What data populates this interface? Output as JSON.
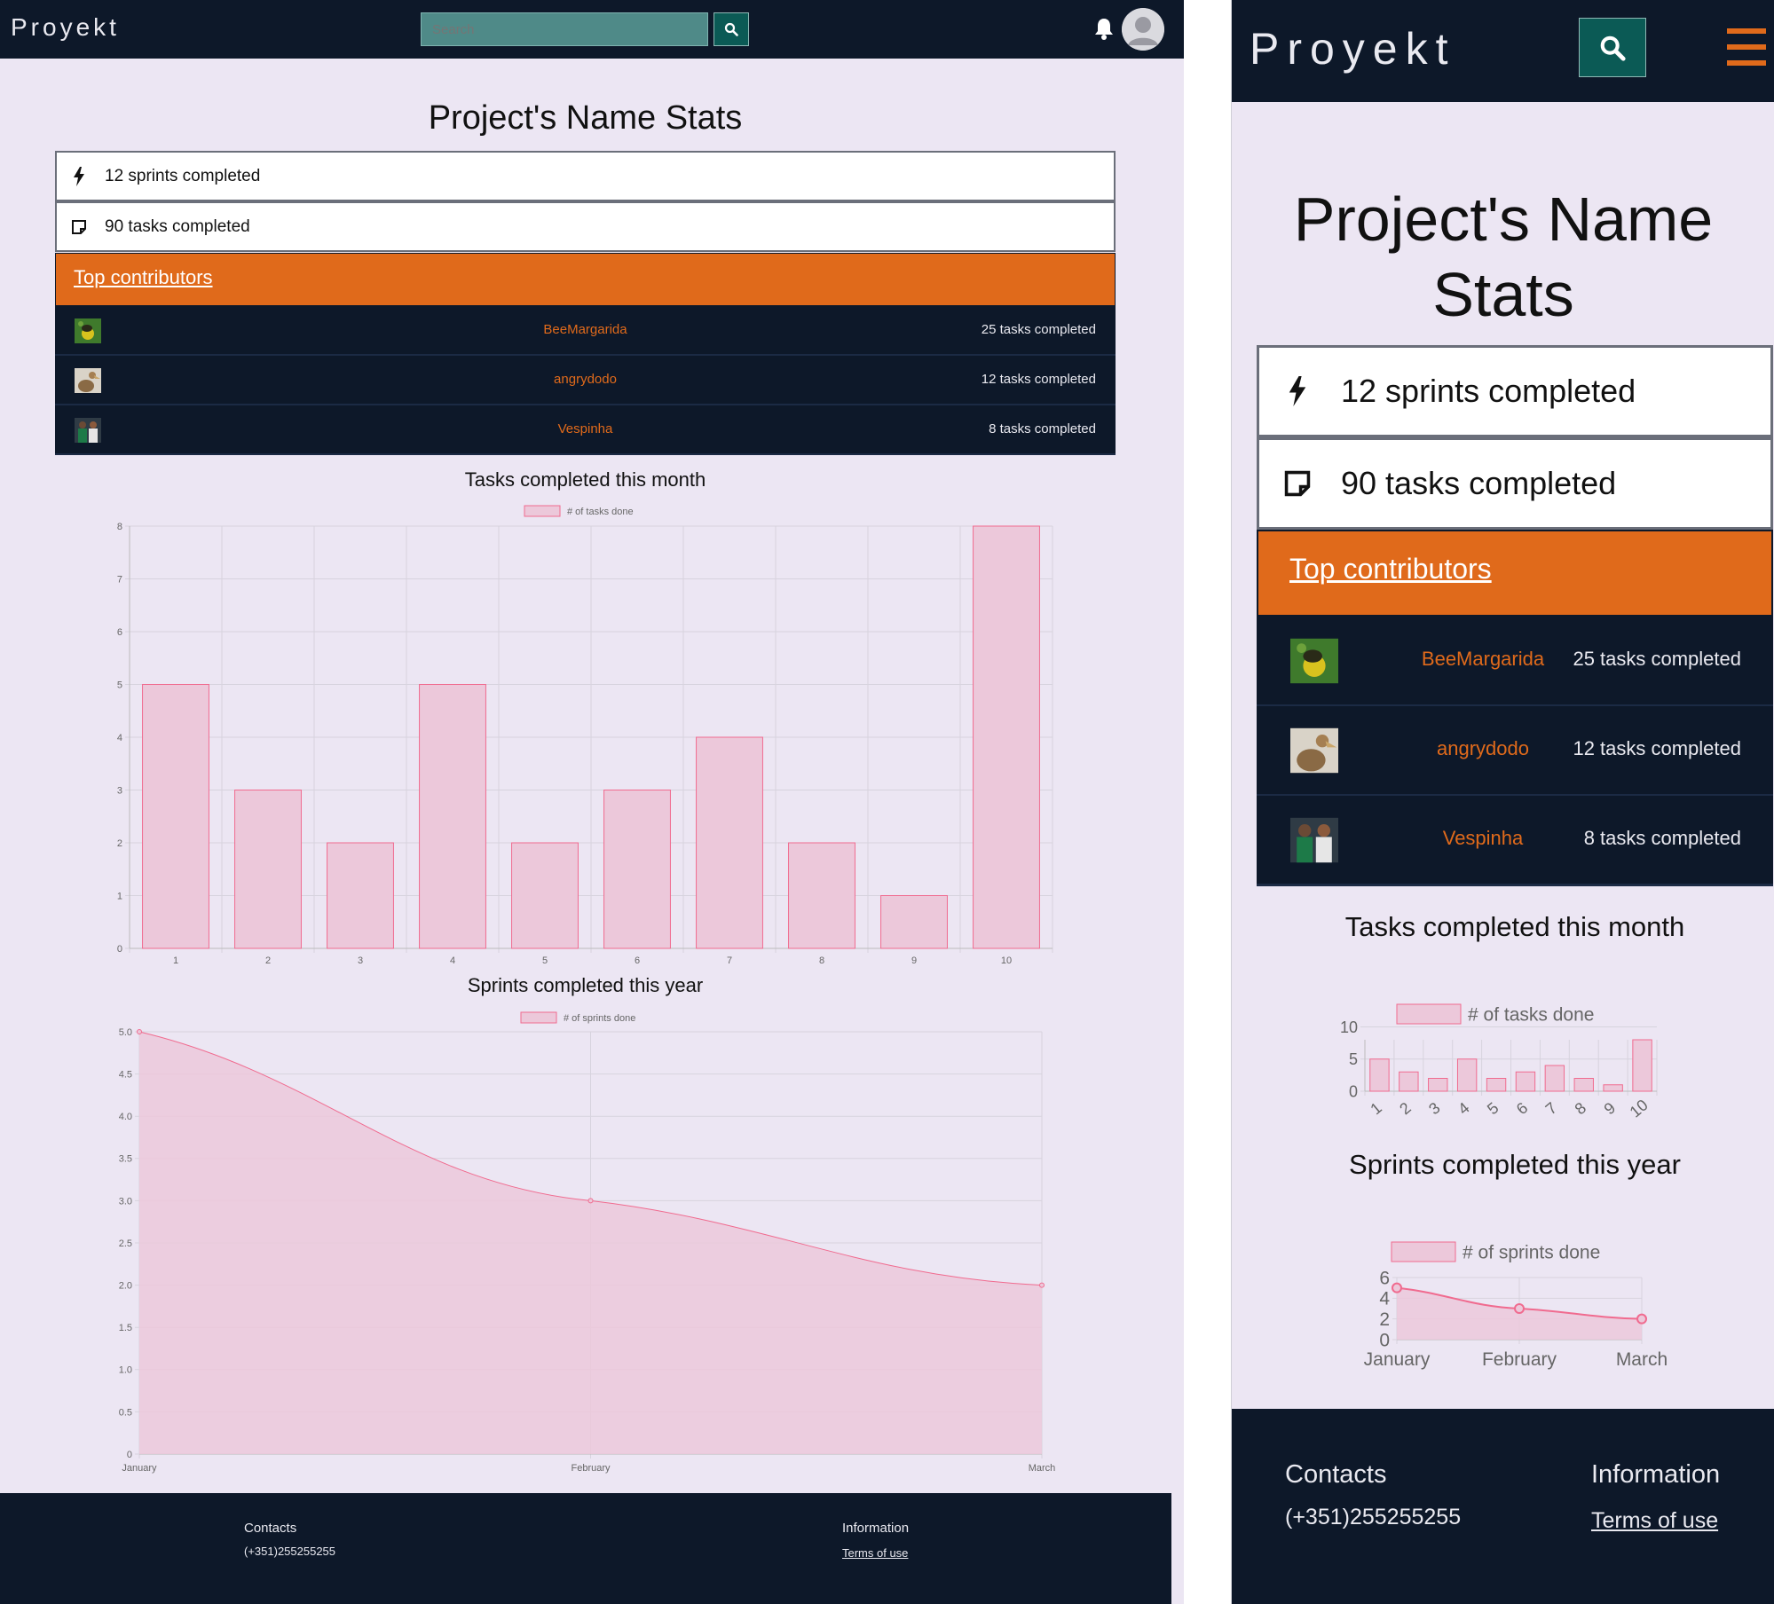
{
  "brand": "Proyekt",
  "search": {
    "placeholder": "Search"
  },
  "icons": {
    "search": "search-icon",
    "bell": "bell-icon",
    "avatar": "avatar-icon",
    "menu": "hamburger-menu-icon",
    "bolt": "bolt-icon",
    "note": "sticky-note-icon"
  },
  "colors": {
    "navbar": "#0d1829",
    "accent": "#e06a1b",
    "background": "#ece6f3",
    "search_button": "#0b5a55",
    "chart_fill": "#ecc8da",
    "chart_stroke": "#f06b8f"
  },
  "page": {
    "title": "Project's Name Stats"
  },
  "stats": {
    "sprints": "12 sprints completed",
    "tasks": "90 tasks completed"
  },
  "contributors": {
    "heading": "Top contributors",
    "items": [
      {
        "name": "BeeMargarida",
        "count": "25 tasks completed"
      },
      {
        "name": "angrydodo",
        "count": "12 tasks completed"
      },
      {
        "name": "Vespinha",
        "count": "8 tasks completed"
      }
    ]
  },
  "chart_data": [
    {
      "type": "bar",
      "title": "Tasks completed this month",
      "categories": [
        "1",
        "2",
        "3",
        "4",
        "5",
        "6",
        "7",
        "8",
        "9",
        "10"
      ],
      "series": [
        {
          "name": "# of tasks done",
          "values": [
            5,
            3,
            2,
            5,
            2,
            3,
            4,
            2,
            1,
            8
          ]
        }
      ],
      "ylim": [
        0,
        8
      ],
      "grid": true,
      "legend": "top"
    },
    {
      "type": "area",
      "title": "Sprints completed this year",
      "categories": [
        "January",
        "February",
        "March"
      ],
      "series": [
        {
          "name": "# of sprints done",
          "values": [
            5,
            3,
            2
          ]
        }
      ],
      "ylim": [
        0,
        5
      ],
      "grid": true,
      "legend": "top"
    }
  ],
  "mobile_ticks": {
    "tasks_y": [
      "10",
      "5",
      "0"
    ],
    "sprints_y": [
      "6",
      "4",
      "2",
      "0"
    ]
  },
  "footer": {
    "contacts_heading": "Contacts",
    "phone": "(+351)255255255",
    "info_heading": "Information",
    "terms": "Terms of use"
  }
}
